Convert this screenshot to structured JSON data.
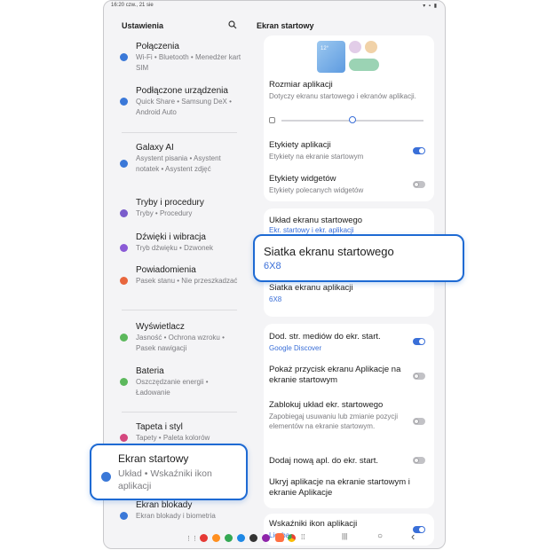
{
  "status": {
    "time": "16:20",
    "date": "czw., 21 sie",
    "icons": "▾ ▪ ▮"
  },
  "left": {
    "title": "Ustawienia",
    "items": [
      {
        "title": "Połączenia",
        "sub": "Wi-Fi • Bluetooth • Menedżer kart SIM",
        "color": "#3a78d8"
      },
      {
        "title": "Podłączone urządzenia",
        "sub": "Quick Share • Samsung DeX • Android Auto",
        "color": "#3a78d8"
      },
      {
        "title": "Galaxy AI",
        "sub": "Asystent pisania • Asystent notatek • Asystent zdjęć",
        "color": "#3a78d8"
      },
      {
        "title": "Tryby i procedury",
        "sub": "Tryby • Procedury",
        "color": "#7a5ccc"
      },
      {
        "title": "Dźwięki i wibracja",
        "sub": "Tryb dźwięku • Dzwonek",
        "color": "#8a5ad6"
      },
      {
        "title": "Powiadomienia",
        "sub": "Pasek stanu • Nie przeszkadzać",
        "color": "#e8663d"
      },
      {
        "title": "Wyświetlacz",
        "sub": "Jasność • Ochrona wzroku • Pasek nawigacji",
        "color": "#5cb85c"
      },
      {
        "title": "Bateria",
        "sub": "Oszczędzanie energii • Ładowanie",
        "color": "#5cb85c"
      },
      {
        "title": "Tapeta i styl",
        "sub": "Tapety • Paleta kolorów",
        "color": "#d4477e"
      },
      {
        "title": "Ekran blokady",
        "sub": "Ekran blokady i biometria",
        "color": "#3a78d8"
      }
    ]
  },
  "callout_left": {
    "title": "Ekran startowy",
    "sub": "Układ • Wskaźniki ikon aplikacji"
  },
  "right": {
    "title": "Ekran startowy",
    "preview_time": "12°",
    "size": {
      "title": "Rozmiar aplikacji",
      "sub": "Dotyczy ekranu startowego i ekranów aplikacji.",
      "level": 0.5
    },
    "labels": {
      "title": "Etykiety aplikacji",
      "sub": "Etykiety na ekranie startowym",
      "on": true
    },
    "widgets": {
      "title": "Etykiety widgetów",
      "sub": "Etykiety polecanych widgetów",
      "on": false
    },
    "layout": {
      "title": "Układ ekranu startowego",
      "value": "Ekr. startowy i ekr. aplikacji"
    },
    "apps_grid": {
      "title": "Siatka ekranu aplikacji",
      "value": "6X8"
    },
    "media": {
      "title": "Dod. str. mediów do ekr. start.",
      "value": "Google Discover",
      "on": true
    },
    "apps_button": {
      "title": "Pokaż przycisk ekranu Aplikacje na ekranie startowym",
      "on": false
    },
    "lock_layout": {
      "title": "Zablokuj układ ekr. startowego",
      "sub": "Zapobiegaj usuwaniu lub zmianie pozycji elementów na ekranie startowym.",
      "on": false
    },
    "add_new": {
      "title": "Dodaj nową apl. do ekr. start.",
      "on": false
    },
    "hide_apps": {
      "title": "Ukryj aplikacje na ekranie startowym i ekranie Aplikacje"
    },
    "badges": {
      "title": "Wskaźniki ikon aplikacji",
      "value": "Liczba",
      "on": true
    }
  },
  "callout_right": {
    "title": "Siatka ekranu startowego",
    "value": "6X8"
  },
  "nav": {
    "back": "‹",
    "home": "○",
    "recents": "|||"
  },
  "colors": {
    "accent": "#3a6fd8",
    "callout_border": "#1e6ad3"
  }
}
